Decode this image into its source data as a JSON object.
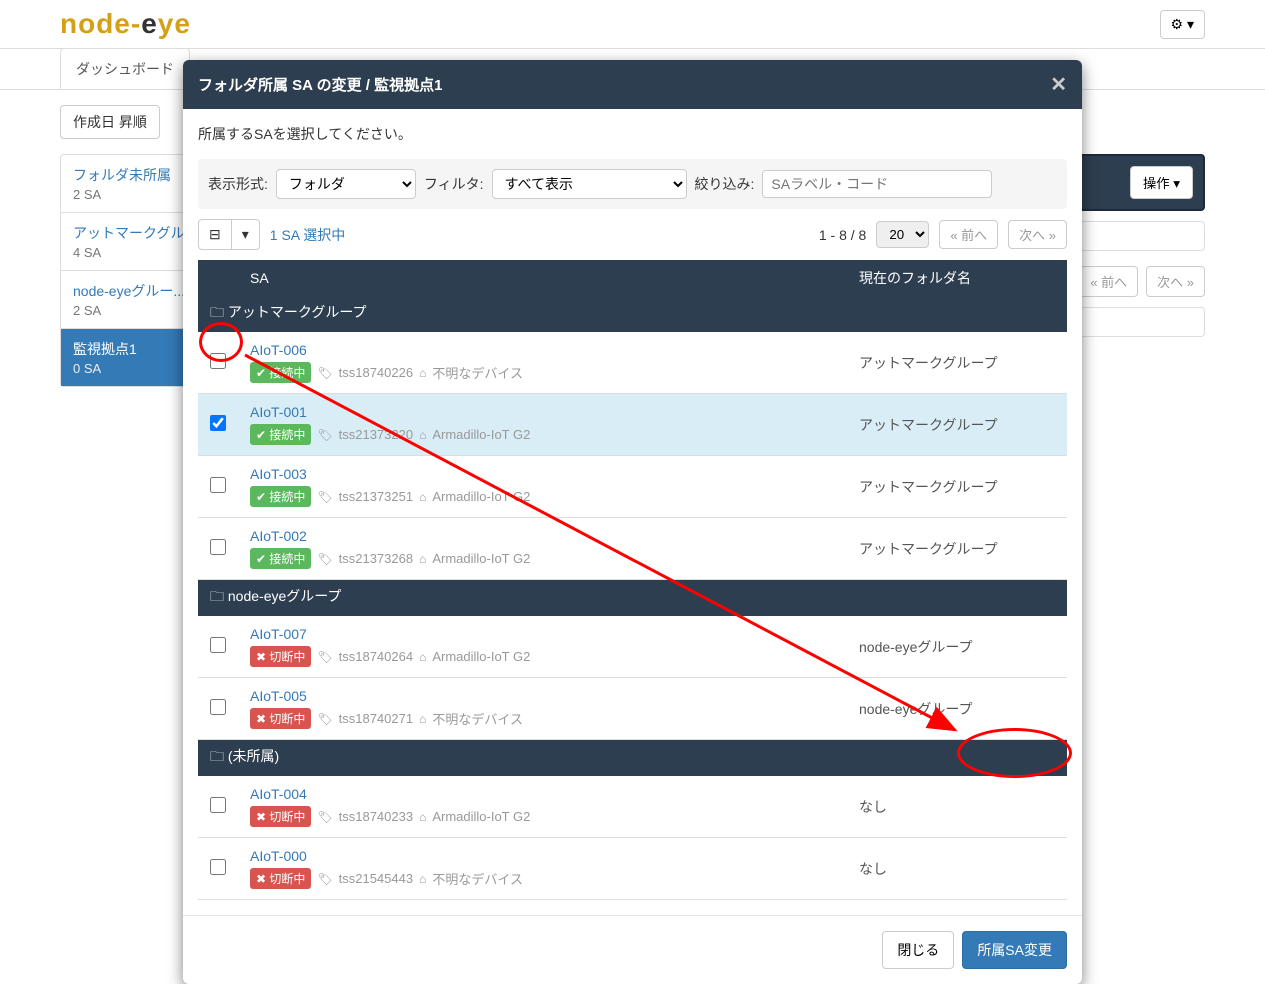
{
  "header": {
    "logo_text": "node-eye",
    "gear_label": "⚙ ▾"
  },
  "nav": {
    "tab1": "ダッシュボード"
  },
  "main": {
    "sort_label": "作成日 昇順",
    "action_label": "操作 ▾",
    "prev_label": "« 前へ",
    "next_label": "次へ »"
  },
  "sidebar": {
    "items": [
      {
        "title": "フォルダ未所属",
        "count": "2 SA"
      },
      {
        "title": "アットマークグルー...",
        "count": "4 SA"
      },
      {
        "title": "node-eyeグルー...",
        "count": "2 SA"
      },
      {
        "title": "監視拠点1",
        "count": "0 SA"
      }
    ]
  },
  "modal": {
    "title": "フォルダ所属 SA の変更 / 監視拠点1",
    "close": "✕",
    "instruction": "所属するSAを選択してください。",
    "filter": {
      "display_label": "表示形式:",
      "display_value": "フォルダ",
      "filter_label": "フィルタ:",
      "filter_value": "すべて表示",
      "search_label": "絞り込み:",
      "search_placeholder": "SAラベル・コード"
    },
    "controls": {
      "indeterminate": "⊟",
      "dropdown": "▾",
      "selection": "1 SA 選択中",
      "range": "1 - 8 / 8",
      "page_size": "20",
      "prev": "« 前へ",
      "next": "次へ »"
    },
    "table": {
      "col_sa": "SA",
      "col_folder": "現在のフォルダ名",
      "groups": [
        {
          "name": "アットマークグループ",
          "rows": [
            {
              "name": "AIoT-006",
              "status": "接続中",
              "status_class": "connected",
              "code": "tss18740226",
              "device": "不明なデバイス",
              "folder": "アットマークグループ",
              "checked": false
            },
            {
              "name": "AIoT-001",
              "status": "接続中",
              "status_class": "connected",
              "code": "tss21373220",
              "device": "Armadillo-IoT G2",
              "folder": "アットマークグループ",
              "checked": true
            },
            {
              "name": "AIoT-003",
              "status": "接続中",
              "status_class": "connected",
              "code": "tss21373251",
              "device": "Armadillo-IoT G2",
              "folder": "アットマークグループ",
              "checked": false
            },
            {
              "name": "AIoT-002",
              "status": "接続中",
              "status_class": "connected",
              "code": "tss21373268",
              "device": "Armadillo-IoT G2",
              "folder": "アットマークグループ",
              "checked": false
            }
          ]
        },
        {
          "name": "node-eyeグループ",
          "rows": [
            {
              "name": "AIoT-007",
              "status": "切断中",
              "status_class": "disconnected",
              "code": "tss18740264",
              "device": "Armadillo-IoT G2",
              "folder": "node-eyeグループ",
              "checked": false
            },
            {
              "name": "AIoT-005",
              "status": "切断中",
              "status_class": "disconnected",
              "code": "tss18740271",
              "device": "不明なデバイス",
              "folder": "node-eyeグループ",
              "checked": false
            }
          ]
        },
        {
          "name": "(未所属)",
          "rows": [
            {
              "name": "AIoT-004",
              "status": "切断中",
              "status_class": "disconnected",
              "code": "tss18740233",
              "device": "Armadillo-IoT G2",
              "folder": "なし",
              "checked": false
            },
            {
              "name": "AIoT-000",
              "status": "切断中",
              "status_class": "disconnected",
              "code": "tss21545443",
              "device": "不明なデバイス",
              "folder": "なし",
              "checked": false
            }
          ]
        }
      ]
    },
    "footer": {
      "close": "閉じる",
      "submit": "所属SA変更"
    }
  },
  "status_icons": {
    "connected": "✔",
    "disconnected": "✖"
  }
}
